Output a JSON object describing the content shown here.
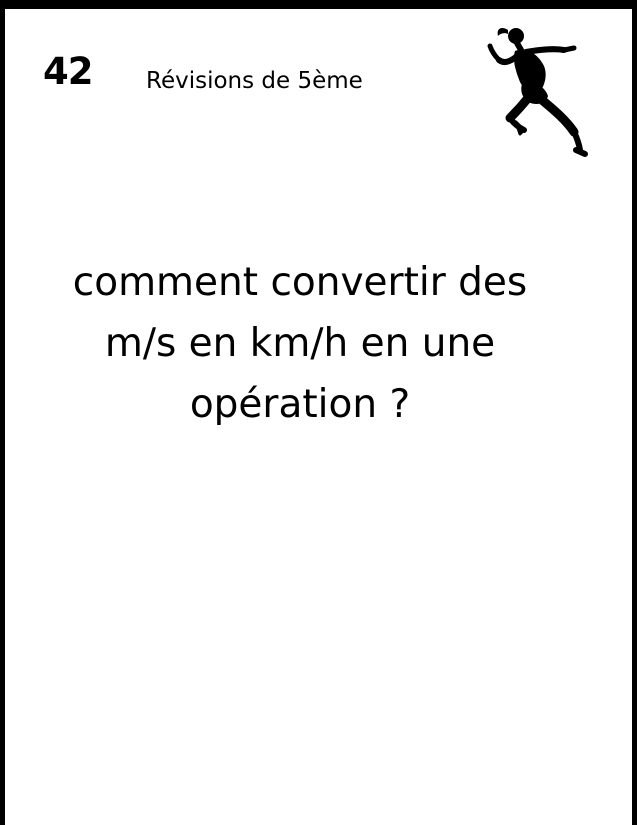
{
  "card": {
    "number": "42",
    "subtitle": "Révisions de 5ème",
    "question": "comment convertir des m/s en km/h en une opération ?",
    "illustration_icon": "runner-icon"
  },
  "colors": {
    "ink": "#000000",
    "background": "#ffffff"
  }
}
